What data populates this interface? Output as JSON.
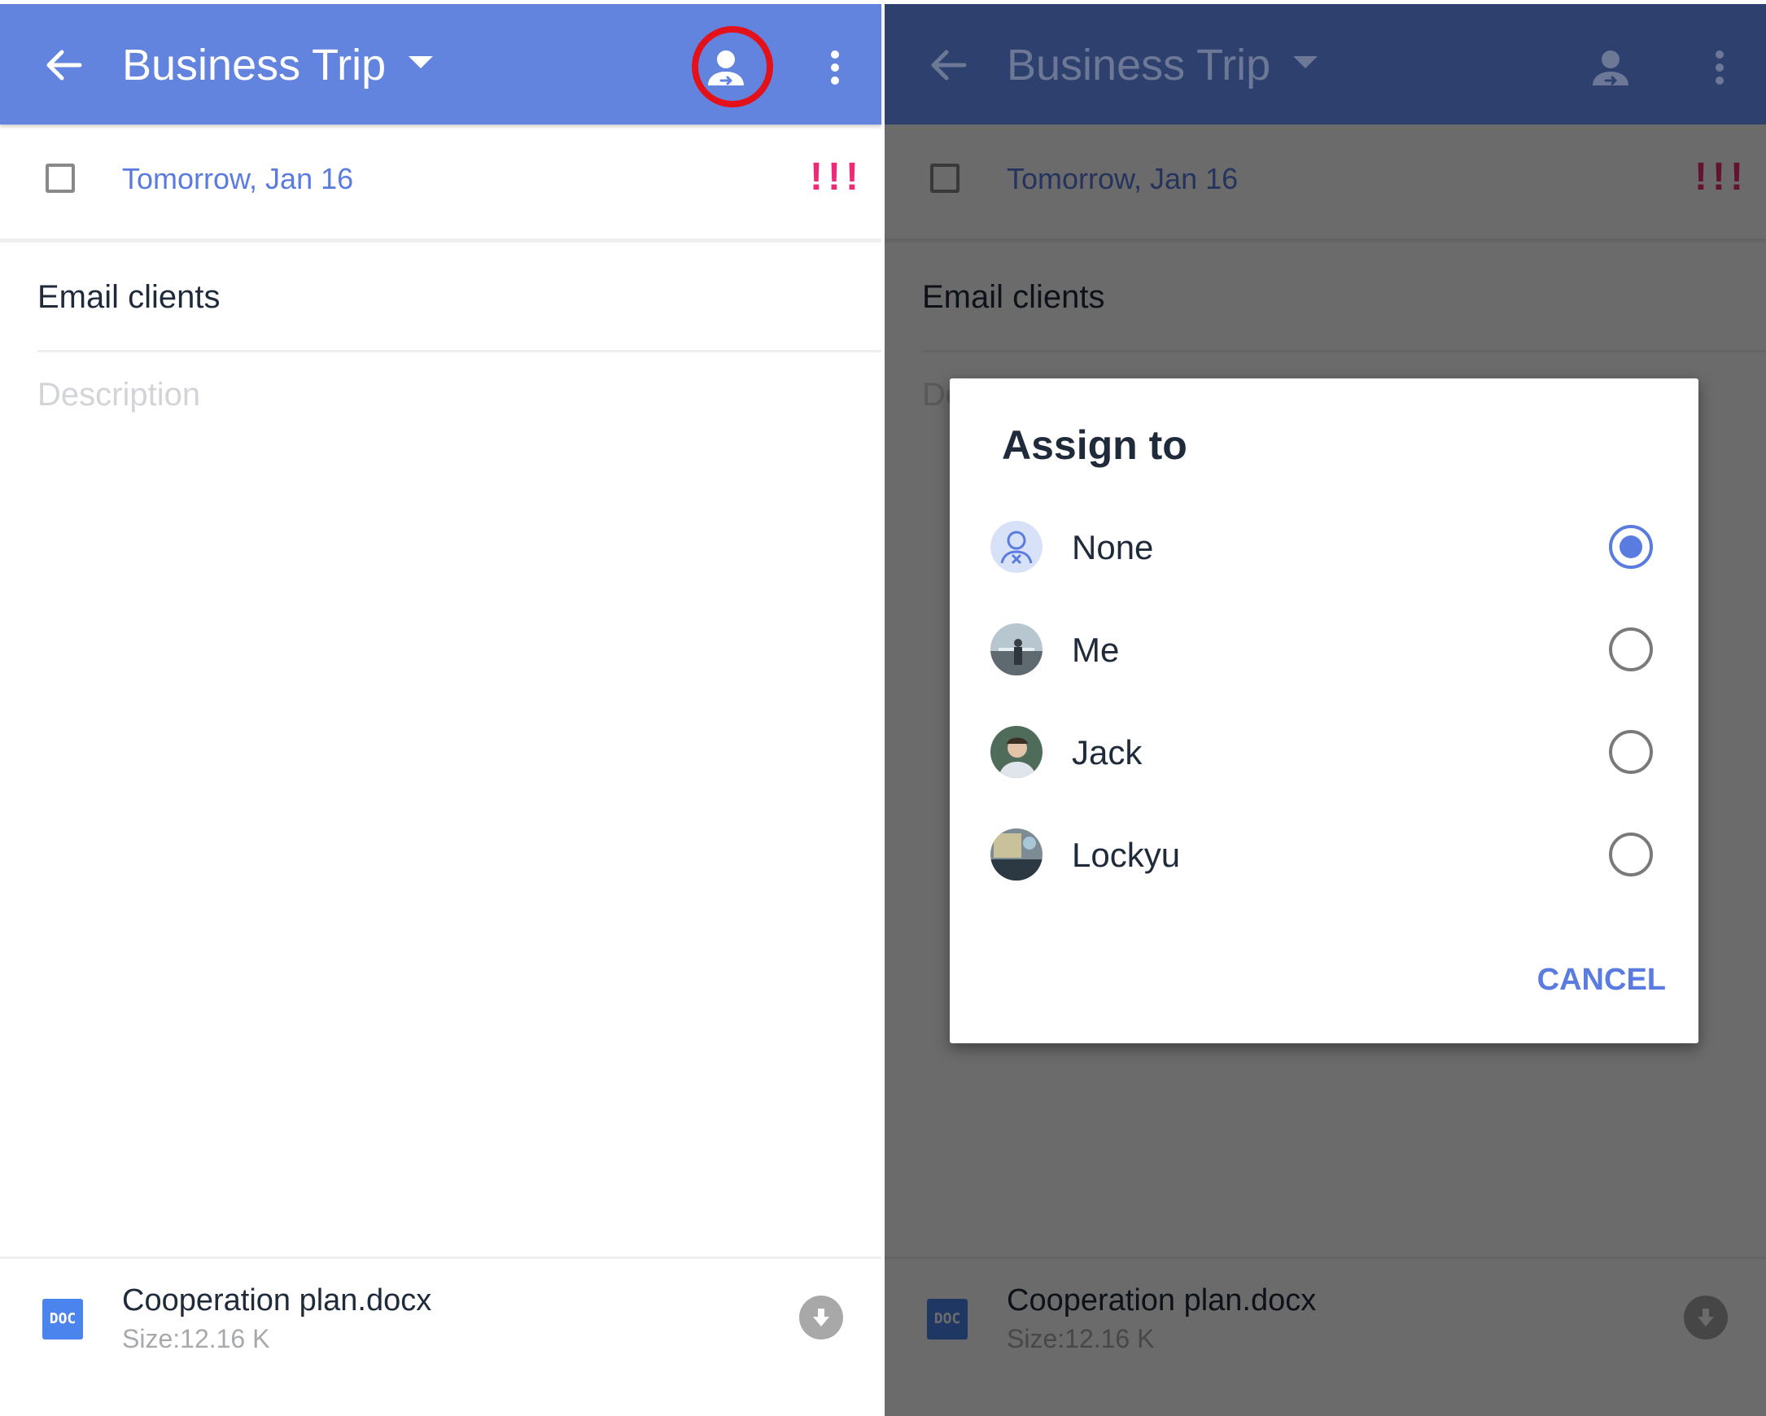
{
  "colors": {
    "appbar": "#6384de",
    "appbar_dimmed": "#2e406e",
    "accent": "#5a7be0",
    "priority": "#ec2b77",
    "highlight_ring": "#e3121a",
    "doc_icon": "#4a84ec"
  },
  "task": {
    "list_name": "Business Trip",
    "due_date": "Tomorrow, Jan 16",
    "priority_marks": "!!!",
    "title": "Email clients",
    "description_placeholder": "Description"
  },
  "attachment": {
    "type_label": "DOC",
    "file_name": "Cooperation plan.docx",
    "size": "Size:12.16 K"
  },
  "icons": {
    "back": "arrow-left-icon",
    "list_dropdown": "caret-down-icon",
    "assign": "assign-person-icon",
    "more": "more-vertical-icon",
    "download": "download-icon"
  },
  "dialog": {
    "title": "Assign to",
    "options": [
      {
        "name": "None",
        "selected": true
      },
      {
        "name": "Me",
        "selected": false
      },
      {
        "name": "Jack",
        "selected": false
      },
      {
        "name": "Lockyu",
        "selected": false
      }
    ],
    "cancel_label": "CANCEL"
  }
}
